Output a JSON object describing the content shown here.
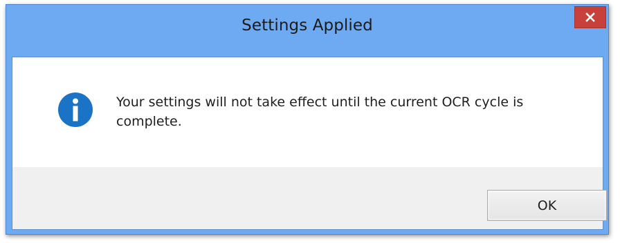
{
  "dialog": {
    "title": "Settings Applied",
    "message": "Your settings will not take effect until the current OCR cycle is complete.",
    "icon": "info-icon",
    "ok_label": "OK",
    "close_icon": "close-icon"
  },
  "colors": {
    "titlebar": "#6eaaf2",
    "close_button": "#c7403a",
    "info_icon": "#1b73c6",
    "footer": "#f0f0f0"
  }
}
